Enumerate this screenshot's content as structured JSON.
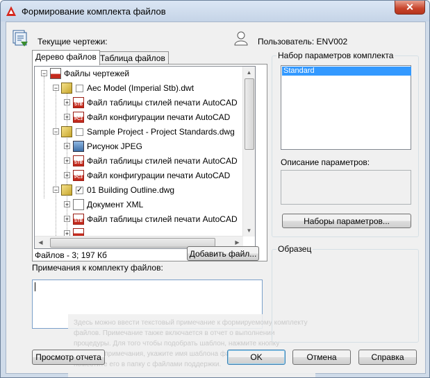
{
  "window": {
    "title": "Формирование комплекта файлов",
    "close_label": "✕"
  },
  "header": {
    "current_drawings_label": "Текущие чертежи:",
    "user_label": "Пользователь: ENV002"
  },
  "tabs": [
    {
      "label": "Дерево файлов",
      "active": true
    },
    {
      "label": "Таблица файлов",
      "active": false
    }
  ],
  "tree": {
    "root_label": "Файлы чертежей",
    "items": [
      {
        "label": "Aec Model (Imperial Stb).dwt",
        "icon": "dwg-icon",
        "checked": false,
        "level": 1
      },
      {
        "label": "Файл таблицы стилей печати AutoCAD",
        "icon": "stb-icon",
        "level": 2
      },
      {
        "label": "Файл конфигурации печати AutoCAD",
        "icon": "pc3-icon",
        "level": 2
      },
      {
        "label": "Sample Project - Project Standards.dwg",
        "icon": "dwg-icon",
        "checked": false,
        "level": 1
      },
      {
        "label": "Рисунок JPEG",
        "icon": "image-icon",
        "level": 2
      },
      {
        "label": "Файл таблицы стилей печати AutoCAD",
        "icon": "stb-icon",
        "level": 2
      },
      {
        "label": "Файл конфигурации печати AutoCAD",
        "icon": "pc3-icon",
        "level": 2
      },
      {
        "label": "01 Building Outline.dwg",
        "icon": "dwg-icon",
        "checked": true,
        "level": 1
      },
      {
        "label": "Документ XML",
        "icon": "xml-icon",
        "level": 2
      },
      {
        "label": "Файл таблицы стилей печати AutoCAD",
        "icon": "stb-icon",
        "level": 2
      }
    ]
  },
  "files_summary": "Файлов - 3; 197 Кб",
  "add_file_button": "Добавить файл...",
  "notes": {
    "label": "Примечания к комплекту файлов:",
    "value": "",
    "hint": "Здесь можно ввести текстовый примечание к формируемому комплекту файлов. Примечание также включается в отчет о выполнении процедуры. Для того чтобы подобрать шаблон, нажмите кнопку шаблона примечания, укажите имя шаблона файл etransmit.txt и поместите его в папку с файлами поддержки."
  },
  "settings": {
    "group_label": "Набор параметров комплекта",
    "items": [
      "Standard"
    ],
    "selected": "Standard",
    "description_label": "Описание параметров:",
    "button": "Наборы параметров..."
  },
  "preview": {
    "group_label": "Образец"
  },
  "footer": {
    "report_button": "Просмотр отчета",
    "ok_button": "OK",
    "cancel_button": "Отмена",
    "help_button": "Справка"
  }
}
